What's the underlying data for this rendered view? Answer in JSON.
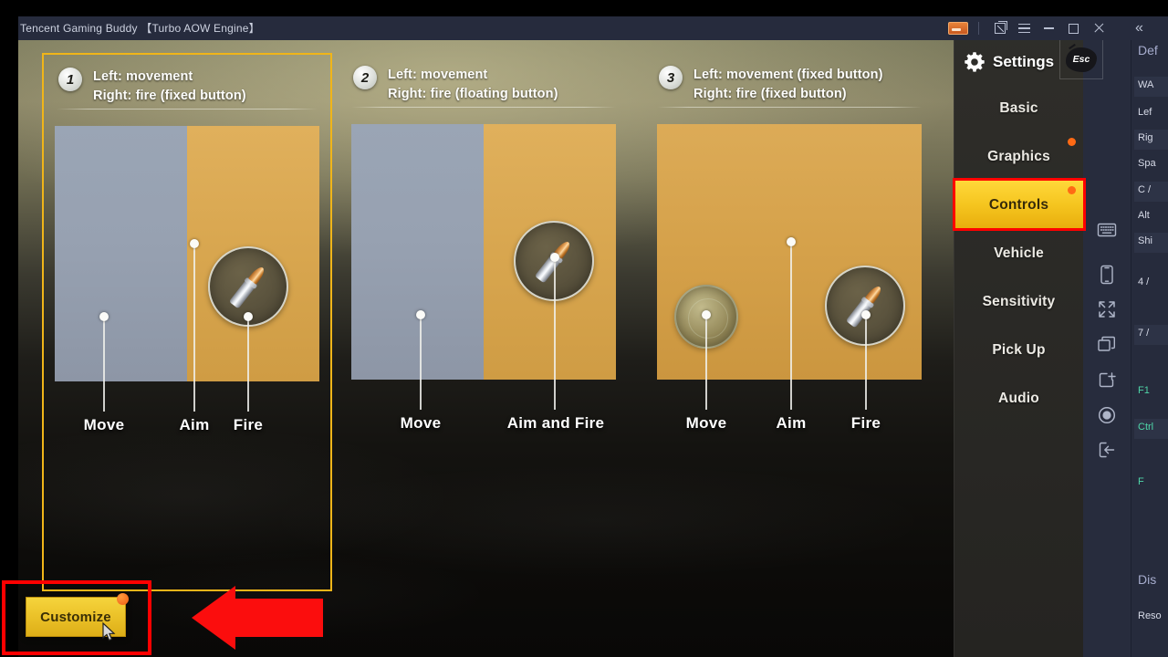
{
  "titlebar": {
    "app_title": "Tencent Gaming Buddy 【Turbo AOW Engine】",
    "icons": [
      {
        "name": "banner-card-icon",
        "label": "banner"
      },
      {
        "name": "popout-window-icon",
        "label": "popout"
      },
      {
        "name": "hamburger-menu-icon",
        "label": "menu"
      },
      {
        "name": "minimize-icon",
        "label": "minimize"
      },
      {
        "name": "maximize-icon",
        "label": "maximize"
      },
      {
        "name": "close-icon",
        "label": "close"
      },
      {
        "name": "collapse-panel-icon",
        "label": "«"
      }
    ]
  },
  "settings": {
    "title": "Settings",
    "esc_label": "Esc",
    "items": [
      {
        "label": "Basic",
        "active": false,
        "badge": false
      },
      {
        "label": "Graphics",
        "active": false,
        "badge": true
      },
      {
        "label": "Controls",
        "active": true,
        "badge": true
      },
      {
        "label": "Vehicle",
        "active": false,
        "badge": false
      },
      {
        "label": "Sensitivity",
        "active": false,
        "badge": false
      },
      {
        "label": "Pick Up",
        "active": false,
        "badge": false
      },
      {
        "label": "Audio",
        "active": false,
        "badge": false
      }
    ]
  },
  "cards": [
    {
      "number": "1",
      "line1": "Left: movement",
      "line2": "Right: fire (fixed button)",
      "selected": true,
      "labels": [
        "Move",
        "Aim",
        "Fire"
      ]
    },
    {
      "number": "2",
      "line1": "Left: movement",
      "line2": "Right: fire (floating button)",
      "selected": false,
      "labels": [
        "Move",
        "Aim and Fire"
      ]
    },
    {
      "number": "3",
      "line1": "Left: movement (fixed button)",
      "line2": "Right: fire (fixed button)",
      "selected": false,
      "labels": [
        "Move",
        "Aim",
        "Fire"
      ]
    }
  ],
  "customize": {
    "label": "Customize",
    "has_badge": true,
    "highlighted": true
  },
  "rail_icons": [
    {
      "name": "keyboard-icon"
    },
    {
      "name": "phone-icon"
    },
    {
      "name": "fullscreen-icon"
    },
    {
      "name": "multi-window-icon"
    },
    {
      "name": "new-window-icon"
    },
    {
      "name": "record-icon"
    },
    {
      "name": "exit-icon"
    }
  ],
  "far_panel": {
    "section1": "Def",
    "rows": [
      {
        "key": "WA",
        "shade": true,
        "green": false
      },
      {
        "key": "Lef",
        "shade": false,
        "green": false
      },
      {
        "key": "Rig",
        "shade": true,
        "green": false
      },
      {
        "key": "Spa",
        "shade": false,
        "green": false
      },
      {
        "key": "C /",
        "shade": true,
        "green": false
      },
      {
        "key": "Alt",
        "shade": false,
        "green": false
      },
      {
        "key": "Shi",
        "shade": true,
        "green": false
      },
      {
        "key": "4 /",
        "shade": false,
        "green": false
      },
      {
        "key": "7 /",
        "shade": true,
        "green": false
      },
      {
        "key": "F1",
        "shade": false,
        "green": true
      },
      {
        "key": "Ctrl",
        "shade": true,
        "green": true
      },
      {
        "key": "F",
        "shade": false,
        "green": true
      }
    ],
    "section2": "Dis",
    "sub2": "Reso"
  },
  "colors": {
    "accent_yellow": "#f5c51f",
    "highlight_red": "#ff0000",
    "badge_orange": "#ff6a14",
    "panel_dark": "#2f2e2a",
    "titlebar": "#262b3d"
  }
}
